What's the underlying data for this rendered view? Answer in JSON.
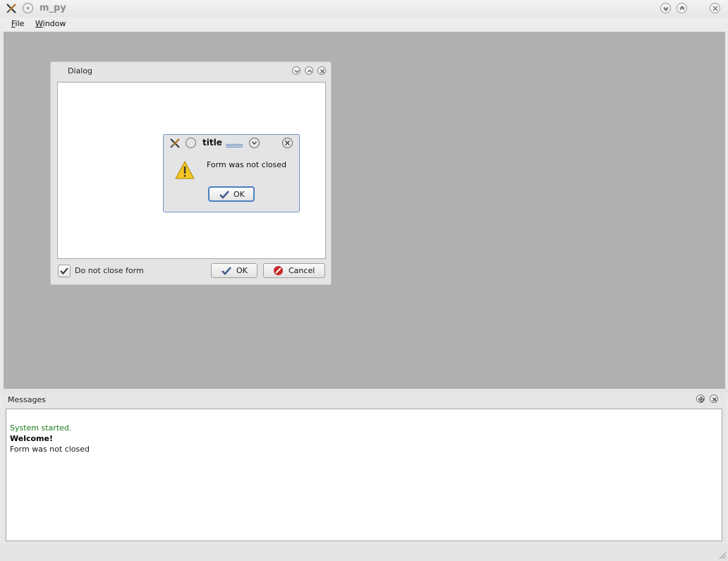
{
  "window": {
    "title": "m_py",
    "icon": "app-tools-icon"
  },
  "menu": {
    "file_underline": "F",
    "file_rest": "ile",
    "window_underline": "W",
    "window_rest": "indow"
  },
  "dialog": {
    "title": "Dialog",
    "checkbox_label": "Do not close form",
    "checkbox_checked": true,
    "ok_label": "OK",
    "cancel_label": "Cancel"
  },
  "message_box": {
    "title": "title",
    "text": "Form was not closed",
    "ok_label": "OK",
    "icon": "warning-icon"
  },
  "messages": {
    "title": "Messages",
    "lines": [
      {
        "text": "System started.",
        "color": "#1e7d1e",
        "weight": "normal"
      },
      {
        "text": "Welcome!",
        "color": "#000000",
        "weight": "bold"
      },
      {
        "text": "Form was not closed",
        "color": "#1a1a1a",
        "weight": "normal"
      }
    ]
  },
  "colors": {
    "mdi_background": "#b0b0ae",
    "msgbox_border": "#6f93c4",
    "accent_blue": "#4a7fc0",
    "cancel_red": "#c62a2a"
  }
}
